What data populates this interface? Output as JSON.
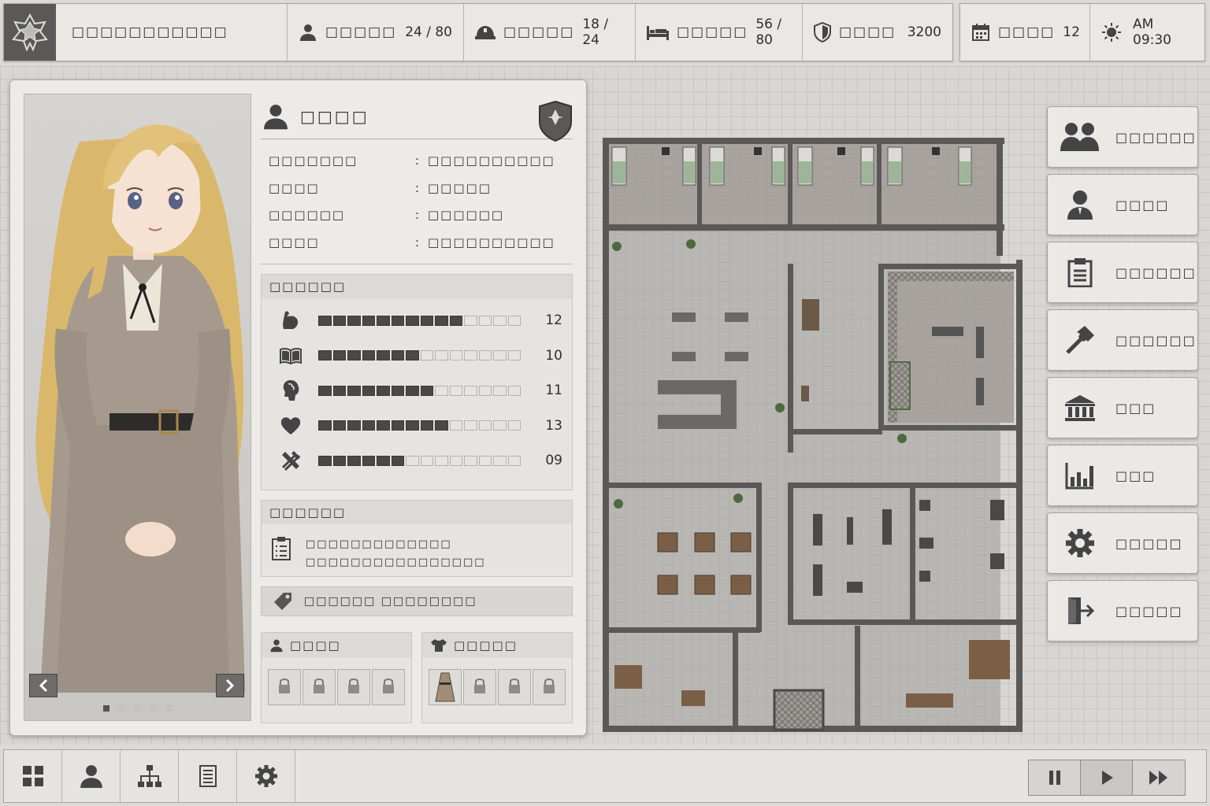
{
  "topbar": {
    "title": "□□□□□□□□□□□",
    "stats": [
      {
        "icon": "person-icon",
        "label": "□□□□□",
        "value": "24 / 80"
      },
      {
        "icon": "helmet-icon",
        "label": "□□□□□",
        "value": "18 / 24"
      },
      {
        "icon": "bed-icon",
        "label": "□□□□□",
        "value": "56 / 80"
      },
      {
        "icon": "shield-icon",
        "label": "□□□□",
        "value": "3200"
      }
    ],
    "day": {
      "icon": "calendar-icon",
      "label": "□□□□",
      "value": "12"
    },
    "time": {
      "icon": "sun-icon",
      "value": "AM 09:30"
    }
  },
  "character": {
    "name": "□□□□",
    "details": [
      {
        "key": "□□□□□□□",
        "value": "□□□□□□□□□□"
      },
      {
        "key": "□□□□",
        "value": "□□□□□"
      },
      {
        "key": "□□□□□□",
        "value": "□□□□□□"
      },
      {
        "key": "□□□□",
        "value": "□□□□□□□□□□"
      }
    ],
    "stats_header": "□□□□□□",
    "stats": [
      {
        "icon": "muscle-icon",
        "filled": 10,
        "total": 14,
        "value": "12"
      },
      {
        "icon": "book-icon",
        "filled": 7,
        "total": 14,
        "value": "10"
      },
      {
        "icon": "head-icon",
        "filled": 8,
        "total": 14,
        "value": "11"
      },
      {
        "icon": "heart-icon",
        "filled": 9,
        "total": 14,
        "value": "13"
      },
      {
        "icon": "tools-icon",
        "filled": 6,
        "total": 14,
        "value": "09"
      }
    ],
    "notes_header": "□□□□□□",
    "notes": [
      "□□□□□□□□□□□□□",
      "□□□□□□□□□□□□□□□□"
    ],
    "tag_text": "□□□□□□ □□□□□□□□",
    "slots_left_title": "□□□□",
    "slots_right_title": "□□□□□",
    "portrait_pages": 5,
    "portrait_current": 1
  },
  "menu": [
    {
      "icon": "group-icon",
      "label": "□□□□□□"
    },
    {
      "icon": "person-icon",
      "label": "□□□□"
    },
    {
      "icon": "clipboard-icon",
      "label": "□□□□□□"
    },
    {
      "icon": "hammer-icon",
      "label": "□□□□□□"
    },
    {
      "icon": "bank-icon",
      "label": "□□□"
    },
    {
      "icon": "chart-icon",
      "label": "□□□"
    },
    {
      "icon": "gear-icon",
      "label": "□□□□□"
    },
    {
      "icon": "exit-icon",
      "label": "□□□□□"
    }
  ],
  "bottombar": {
    "buttons": [
      "grid-icon",
      "person-icon",
      "org-chart-icon",
      "list-icon",
      "gear-icon"
    ],
    "speed": [
      "pause-icon",
      "play-icon",
      "fast-forward-icon"
    ]
  },
  "colors": {
    "panel": "#edebe8",
    "dark": "#4a4947",
    "bg": "#dcdad6"
  }
}
